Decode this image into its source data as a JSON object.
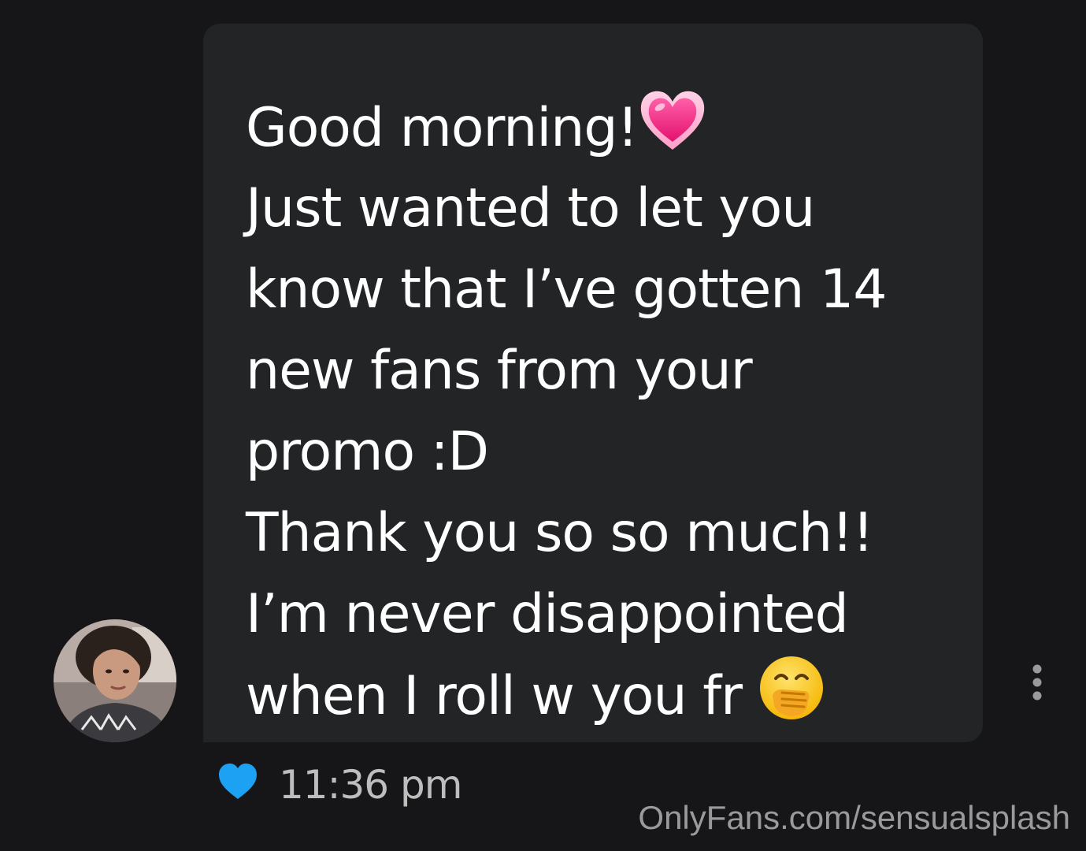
{
  "message": {
    "lines": [
      "Good morning!",
      "Just wanted to let you",
      "know that I’ve gotten 14",
      "new fans from your",
      "promo :D",
      "Thank you so so much!!",
      "I’m never disappointed",
      "when I roll w you fr "
    ],
    "emojis": {
      "line1": "growing-heart-icon",
      "line8": "face-with-hand-over-mouth-icon"
    },
    "timestamp": "11:36 pm",
    "liked": true,
    "like_color": "#1da1f2"
  },
  "watermark": "OnlyFans.com/sensualsplash",
  "colors": {
    "background": "#161618",
    "bubble": "#222426",
    "text": "#ffffff",
    "timestamp": "#bdbdbd"
  }
}
